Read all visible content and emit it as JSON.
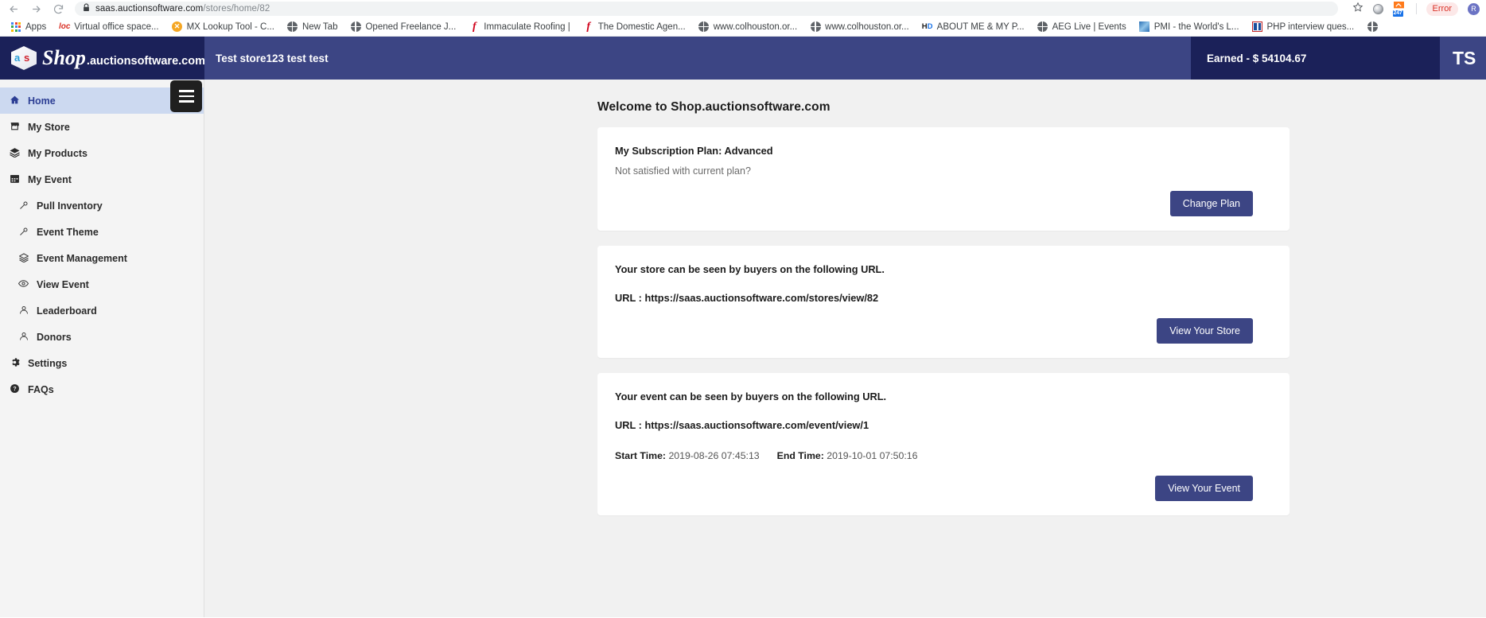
{
  "browser": {
    "url_host": "saas.auctionsoftware.com",
    "url_path": "/stores/home/82",
    "back_icon": "back-arrow-icon",
    "forward_icon": "forward-arrow-icon",
    "reload_icon": "reload-icon",
    "lock_icon": "lock-icon",
    "star_icon": "bookmark-star-icon",
    "extension_badge_count": "247",
    "error_label": "Error",
    "profile_initial": "R",
    "bookmarks": [
      {
        "label": "Apps",
        "icon": "apps-grid-icon"
      },
      {
        "label": "Virtual office space...",
        "icon": "loc-icon"
      },
      {
        "label": "MX Lookup Tool - C...",
        "icon": "mx-icon"
      },
      {
        "label": "New Tab",
        "icon": "globe-icon"
      },
      {
        "label": "Opened Freelance J...",
        "icon": "globe-icon"
      },
      {
        "label": "Immaculate Roofing |",
        "icon": "f-script-icon"
      },
      {
        "label": "The Domestic Agen...",
        "icon": "f-script-icon"
      },
      {
        "label": "www.colhouston.or...",
        "icon": "globe-icon"
      },
      {
        "label": "www.colhouston.or...",
        "icon": "globe-icon"
      },
      {
        "label": "ABOUT ME & MY P...",
        "icon": "hd-icon"
      },
      {
        "label": "AEG Live | Events",
        "icon": "globe-icon"
      },
      {
        "label": "PMI - the World's L...",
        "icon": "pmi-icon"
      },
      {
        "label": "PHP interview ques...",
        "icon": "php-icon"
      },
      {
        "label": "",
        "icon": "globe-icon"
      }
    ]
  },
  "header": {
    "brand_name": "Shop",
    "brand_domain": ".auctionsoftware.com",
    "brand_logo_left": "a",
    "brand_logo_right": "s",
    "store_title": "Test store123 test test",
    "earned_label": "Earned - $ 54104.67",
    "user_initials": "TS"
  },
  "sidebar": {
    "hamburger_icon": "hamburger-menu-icon",
    "items": [
      {
        "label": "Home",
        "icon": "home-icon",
        "glyph": "⌂",
        "active": true,
        "sub": false
      },
      {
        "label": "My Store",
        "icon": "store-icon",
        "glyph": "⌂",
        "active": false,
        "sub": false
      },
      {
        "label": "My Products",
        "icon": "layers-icon",
        "glyph": "≣",
        "active": false,
        "sub": false
      },
      {
        "label": "My Event",
        "icon": "calendar-icon",
        "glyph": "☷",
        "active": false,
        "sub": false
      },
      {
        "label": "Pull Inventory",
        "icon": "pin-icon",
        "glyph": "⚘",
        "active": false,
        "sub": true
      },
      {
        "label": "Event Theme",
        "icon": "pin-icon",
        "glyph": "⚘",
        "active": false,
        "sub": true
      },
      {
        "label": "Event Management",
        "icon": "layers-icon",
        "glyph": "≣",
        "active": false,
        "sub": true
      },
      {
        "label": "View Event",
        "icon": "eye-icon",
        "glyph": "◉",
        "active": false,
        "sub": true
      },
      {
        "label": "Leaderboard",
        "icon": "user-icon",
        "glyph": "♟",
        "active": false,
        "sub": true
      },
      {
        "label": "Donors",
        "icon": "user-icon",
        "glyph": "♟",
        "active": false,
        "sub": true
      },
      {
        "label": "Settings",
        "icon": "gear-icon",
        "glyph": "⚙",
        "active": false,
        "sub": false
      },
      {
        "label": "FAQs",
        "icon": "question-circle-icon",
        "glyph": "?",
        "active": false,
        "sub": false
      }
    ]
  },
  "main": {
    "welcome_title": "Welcome to Shop.auctionsoftware.com",
    "subscription_card": {
      "title": "My Subscription Plan: Advanced",
      "subtitle": "Not satisfied with current plan?",
      "button_label": "Change Plan"
    },
    "store_card": {
      "line": "Your store can be seen by buyers on the following URL.",
      "url_label": "URL : https://saas.auctionsoftware.com/stores/view/82",
      "button_label": "View Your Store"
    },
    "event_card": {
      "line": "Your event can be seen by buyers on the following URL.",
      "url_label": "URL : https://saas.auctionsoftware.com/event/view/1",
      "start_time_label": "Start Time:",
      "start_time_value": "2019-08-26 07:45:13",
      "end_time_label": "End Time:",
      "end_time_value": "2019-10-01 07:50:16",
      "button_label": "View Your Event"
    }
  },
  "colors": {
    "header_dark": "#1b2159",
    "header_mid": "#3c4584",
    "accent_button": "#3c4584",
    "sidebar_bg": "#f4f4f4",
    "active_item": "#ccd9f0",
    "content_bg": "#f1f1f1"
  }
}
